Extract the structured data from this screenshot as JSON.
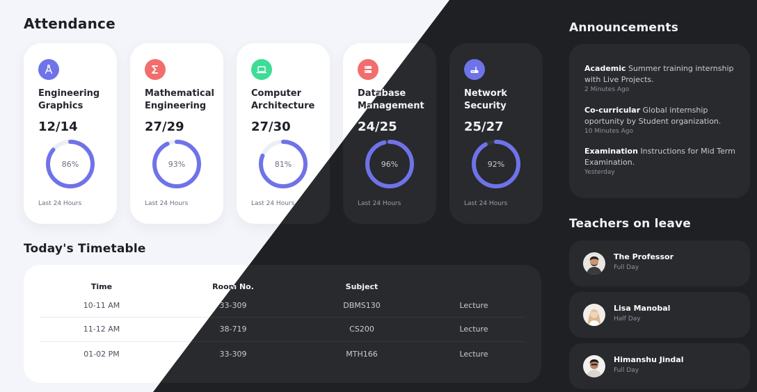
{
  "attendance": {
    "title": "Attendance",
    "courses": [
      {
        "name": "Engineering Graphics",
        "count": "12/14",
        "percent": "86%",
        "value": 86,
        "footer": "Last 24 Hours",
        "icon": "compass-icon",
        "icon_color": "#6f73e8"
      },
      {
        "name": "Mathematical Engineering",
        "count": "27/29",
        "percent": "93%",
        "value": 93,
        "footer": "Last 24 Hours",
        "icon": "sigma-icon",
        "icon_color": "#f26d6d"
      },
      {
        "name": "Computer Architecture",
        "count": "27/30",
        "percent": "81%",
        "value": 81,
        "footer": "Last 24 Hours",
        "icon": "laptop-icon",
        "icon_color": "#3ddc97"
      },
      {
        "name": "Database Management",
        "count": "24/25",
        "percent": "96%",
        "value": 96,
        "footer": "Last 24 Hours",
        "icon": "server-icon",
        "icon_color": "#f26d6d"
      },
      {
        "name": "Network Security",
        "count": "25/27",
        "percent": "92%",
        "value": 92,
        "footer": "Last 24 Hours",
        "icon": "router-icon",
        "icon_color": "#6f73e8"
      }
    ]
  },
  "timetable": {
    "title": "Today's Timetable",
    "headers": {
      "time": "Time",
      "room": "Room No.",
      "subject": "Subject"
    },
    "rows": [
      {
        "time": "10-11 AM",
        "room": "33-309",
        "subject": "DBMS130",
        "type": "Lecture"
      },
      {
        "time": "11-12 AM",
        "room": "38-719",
        "subject": "CS200",
        "type": "Lecture"
      },
      {
        "time": "01-02 PM",
        "room": "33-309",
        "subject": "MTH166",
        "type": "Lecture"
      }
    ]
  },
  "announcements": {
    "title": "Announcements",
    "items": [
      {
        "category": "Academic",
        "text": "Summer training internship with Live Projects.",
        "time": "2 Minutes Ago"
      },
      {
        "category": "Co-curricular",
        "text": "Global internship oportunity by Student organization.",
        "time": "10 Minutes Ago"
      },
      {
        "category": "Examination",
        "text": "Instructions for Mid Term Examination.",
        "time": "Yesterday"
      }
    ]
  },
  "teachers_on_leave": {
    "title": "Teachers on leave",
    "items": [
      {
        "name": "The Professor",
        "leave": "Full Day"
      },
      {
        "name": "Lisa Manobal",
        "leave": "Half Day"
      },
      {
        "name": "Himanshu Jindal",
        "leave": "Full Day"
      }
    ]
  },
  "colors": {
    "ring": "#6f73e8",
    "ring_track_light": "#eceef6",
    "ring_track_dark": "#34373c",
    "light_bg": "#f4f5fa",
    "dark_bg": "#1e2023"
  }
}
